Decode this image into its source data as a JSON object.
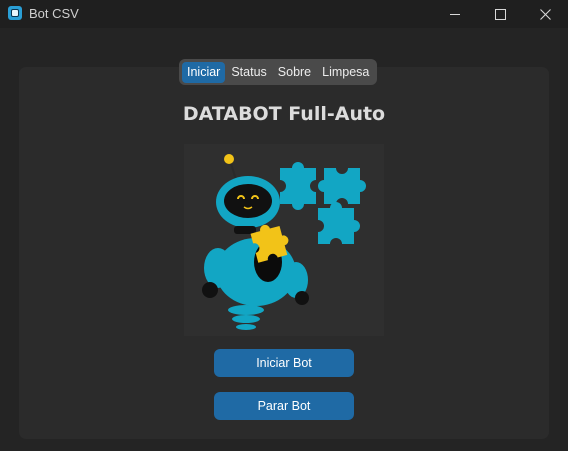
{
  "window": {
    "title": "Bot CSV",
    "icons": {
      "app": "app-icon",
      "minimize": "minimize-icon",
      "maximize": "maximize-icon",
      "close": "close-icon"
    }
  },
  "tabs": [
    {
      "label": "Iniciar",
      "active": true
    },
    {
      "label": "Status",
      "active": false
    },
    {
      "label": "Sobre",
      "active": false
    },
    {
      "label": "Limpesa",
      "active": false
    }
  ],
  "main": {
    "title": "DATABOT Full-Auto",
    "illustration": "robot-puzzle-illustration",
    "start_button": "Iniciar Bot",
    "stop_button": "Parar Bot"
  },
  "colors": {
    "accent": "#1f6aa5",
    "robot_teal": "#12a6c4",
    "puzzle_yellow": "#f2c318",
    "background": "#242424",
    "panel": "#2b2b2b"
  }
}
